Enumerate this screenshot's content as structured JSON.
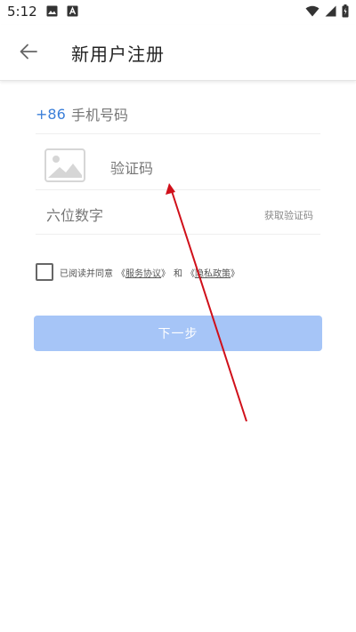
{
  "status_bar": {
    "time": "5:12",
    "left_icons": [
      "image-icon",
      "a-square-icon"
    ],
    "right_icons": [
      "wifi-icon",
      "cell-signal-icon",
      "battery-icon"
    ]
  },
  "app_bar": {
    "title": "新用户注册",
    "back_icon": "arrow-back-icon"
  },
  "form": {
    "country_code": "+86",
    "phone_placeholder": "手机号码",
    "captcha_placeholder": "验证码",
    "sms_code_placeholder": "六位数字",
    "get_code_label": "获取验证码"
  },
  "agreement": {
    "prefix": "已阅读并同意",
    "service_open": "《",
    "service_label": "服务协议",
    "service_close": "》",
    "and": "和",
    "privacy_open": "《",
    "privacy_label": "隐私政策",
    "privacy_close": "》",
    "checked": false
  },
  "next_button": {
    "label": "下一步",
    "enabled": false
  },
  "colors": {
    "accent": "#3b7fd9",
    "button_disabled": "#a6c5f7",
    "annotation_arrow": "#d0101a"
  }
}
